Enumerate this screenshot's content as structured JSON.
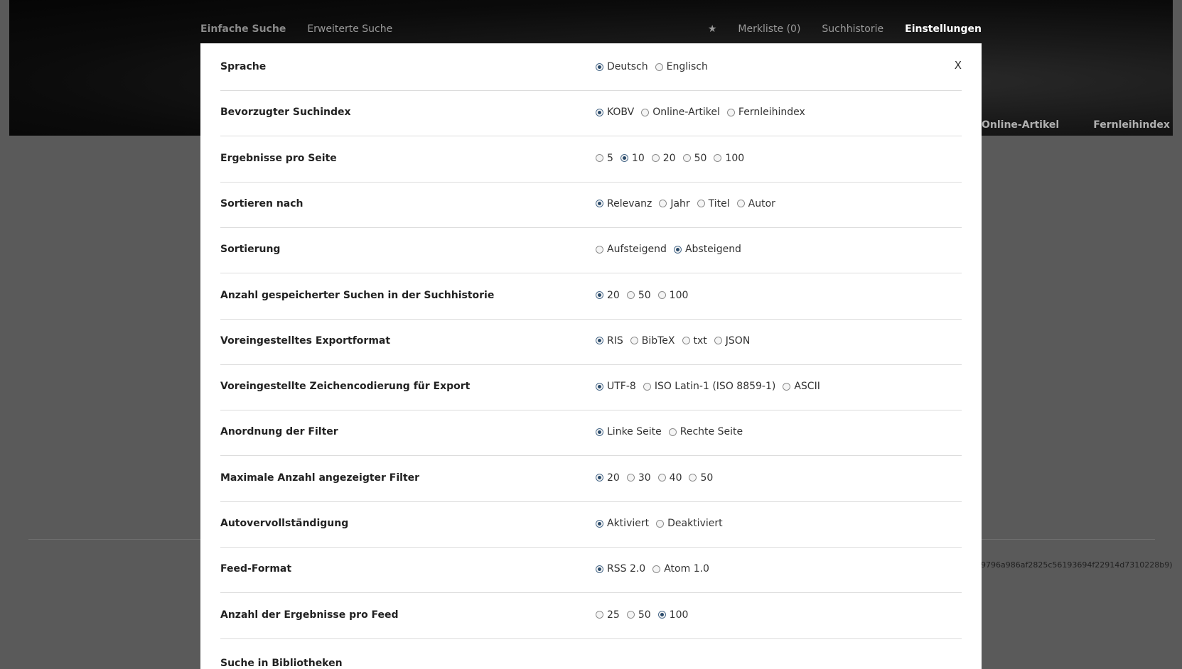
{
  "nav_left": [
    "Einfache Suche",
    "Erweiterte Suche"
  ],
  "nav_right": {
    "merkliste": "Merkliste (0)",
    "suchhistorie": "Suchhistorie",
    "einstellungen": "Einstellungen"
  },
  "bg_tabs": [
    "Online-Artikel",
    "Fernleihindex"
  ],
  "bg_hash": "9796a986af2825c56193694f22914d7310228b9)",
  "close_label": "X",
  "settings": [
    {
      "label": "Sprache",
      "options": [
        "Deutsch",
        "Englisch"
      ],
      "selected": 0
    },
    {
      "label": "Bevorzugter Suchindex",
      "options": [
        "KOBV",
        "Online-Artikel",
        "Fernleihindex"
      ],
      "selected": 0
    },
    {
      "label": "Ergebnisse pro Seite",
      "options": [
        "5",
        "10",
        "20",
        "50",
        "100"
      ],
      "selected": 1
    },
    {
      "label": "Sortieren nach",
      "options": [
        "Relevanz",
        "Jahr",
        "Titel",
        "Autor"
      ],
      "selected": 0
    },
    {
      "label": "Sortierung",
      "options": [
        "Aufsteigend",
        "Absteigend"
      ],
      "selected": 1
    },
    {
      "label": "Anzahl gespeicherter Suchen in der Suchhistorie",
      "options": [
        "20",
        "50",
        "100"
      ],
      "selected": 0
    },
    {
      "label": "Voreingestelltes Exportformat",
      "options": [
        "RIS",
        "BibTeX",
        "txt",
        "JSON"
      ],
      "selected": 0
    },
    {
      "label": "Voreingestellte Zeichencodierung für Export",
      "options": [
        "UTF-8",
        "ISO Latin-1 (ISO 8859-1)",
        "ASCII"
      ],
      "selected": 0
    },
    {
      "label": "Anordnung der Filter",
      "options": [
        "Linke Seite",
        "Rechte Seite"
      ],
      "selected": 0
    },
    {
      "label": "Maximale Anzahl angezeigter Filter",
      "options": [
        "20",
        "30",
        "40",
        "50"
      ],
      "selected": 0
    },
    {
      "label": "Autovervollständigung",
      "options": [
        "Aktiviert",
        "Deaktiviert"
      ],
      "selected": 0
    },
    {
      "label": "Feed-Format",
      "options": [
        "RSS 2.0",
        "Atom 1.0"
      ],
      "selected": 0
    },
    {
      "label": "Anzahl der Ergebnisse pro Feed",
      "options": [
        "25",
        "50",
        "100"
      ],
      "selected": 2
    }
  ],
  "partial_label": "Suche in Bibliotheken"
}
